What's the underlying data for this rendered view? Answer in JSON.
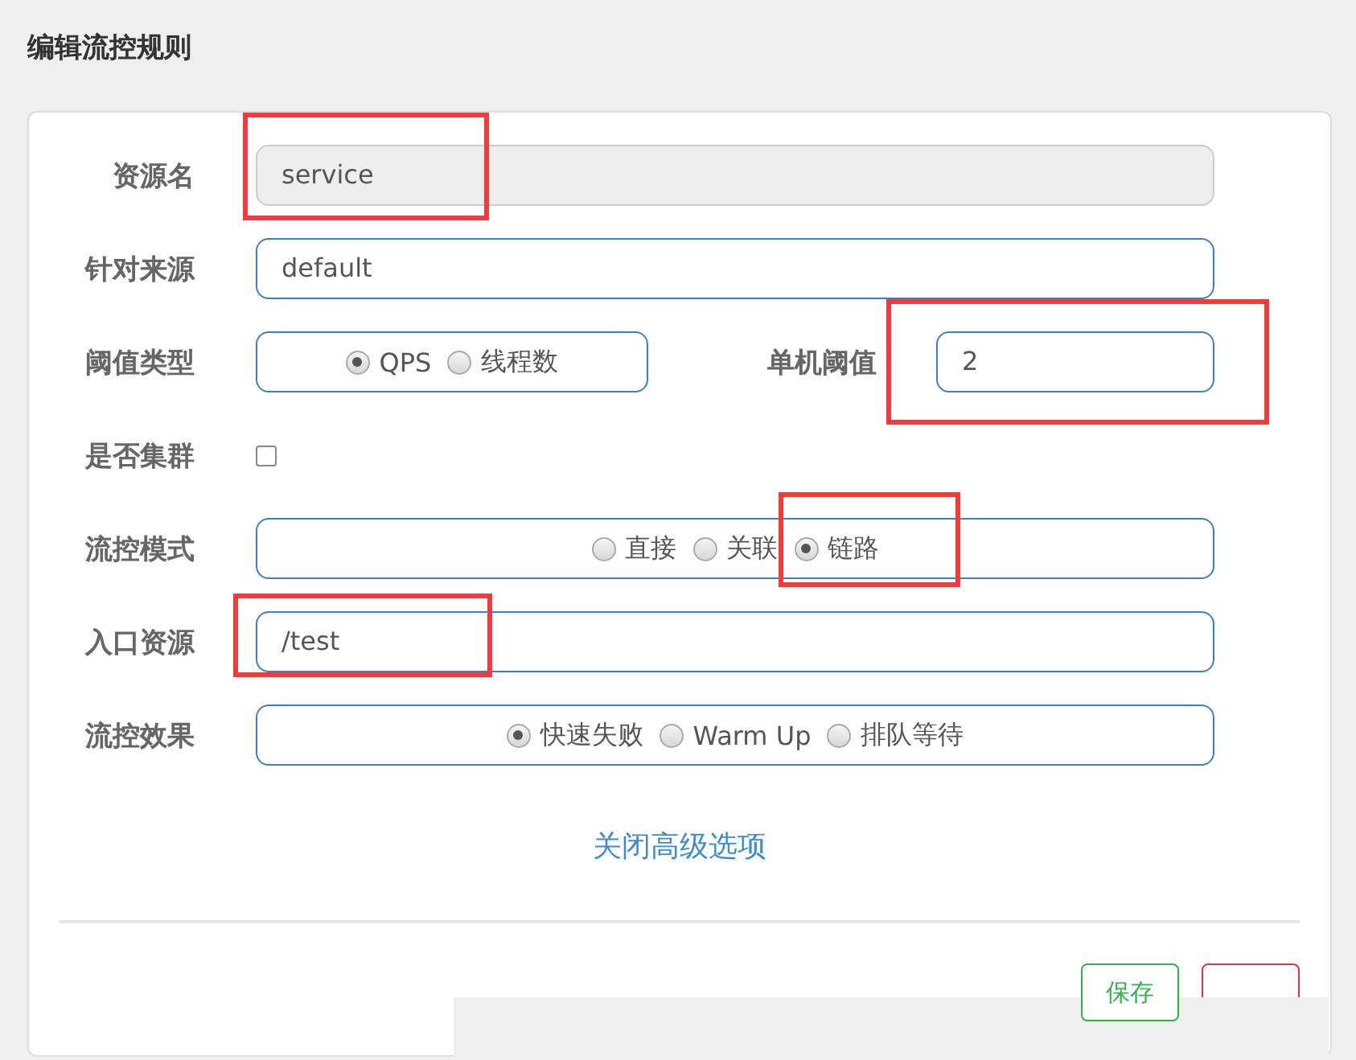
{
  "title": "编辑流控规则",
  "rows": [
    {
      "kind": "text",
      "label": "资源名",
      "value": "service",
      "disabled": true,
      "annotated": true
    },
    {
      "kind": "text",
      "label": "针对来源",
      "value": "default",
      "disabled": false,
      "annotated": false
    },
    {
      "kind": "split",
      "label": "阈值类型",
      "options": [
        {
          "label": "QPS",
          "selected": true,
          "annotated": false
        },
        {
          "label": "线程数",
          "selected": false,
          "annotated": false
        }
      ],
      "side": {
        "label": "单机阈值",
        "value": "2",
        "annotated": true
      }
    },
    {
      "kind": "checkbox",
      "label": "是否集群",
      "checked": false
    },
    {
      "kind": "radio",
      "label": "流控模式",
      "options": [
        {
          "label": "直接",
          "selected": false,
          "annotated": false
        },
        {
          "label": "关联",
          "selected": false,
          "annotated": false
        },
        {
          "label": "链路",
          "selected": true,
          "annotated": true
        }
      ]
    },
    {
      "kind": "text",
      "label": "入口资源",
      "value": "/test",
      "disabled": false,
      "annotated": true
    },
    {
      "kind": "radio",
      "label": "流控效果",
      "options": [
        {
          "label": "快速失败",
          "selected": true,
          "annotated": false
        },
        {
          "label": "Warm Up",
          "selected": false,
          "annotated": false
        },
        {
          "label": "排队等待",
          "selected": false,
          "annotated": false
        }
      ]
    }
  ],
  "toggle_link": "关闭高级选项",
  "buttons": [
    {
      "kind": "save",
      "label": "保存"
    },
    {
      "kind": "cancel"
    }
  ]
}
